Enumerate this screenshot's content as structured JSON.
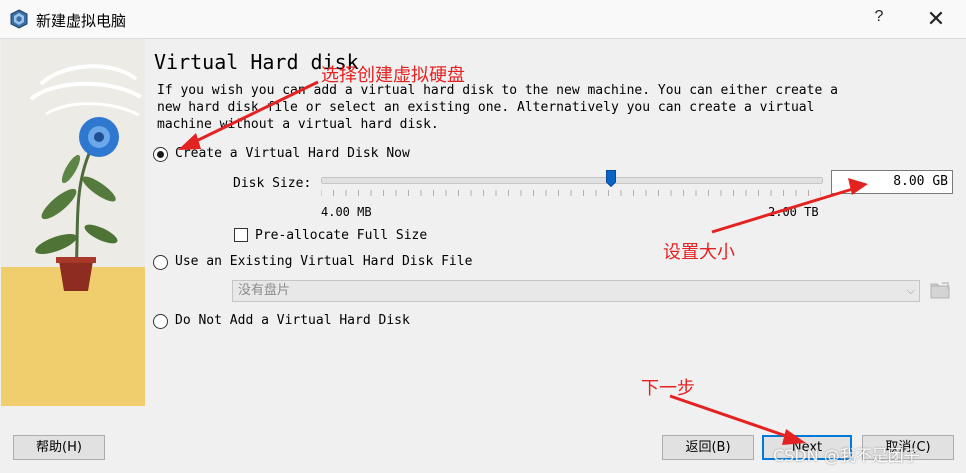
{
  "window": {
    "title": "新建虚拟电脑",
    "help_glyph": "?",
    "close_glyph": "✕"
  },
  "page": {
    "heading": "Virtual Hard disk",
    "description": "If you wish you can add a virtual hard disk to the new machine. You can either create a new hard disk file or select an existing one. Alternatively you can create a virtual machine without a virtual hard disk."
  },
  "options": {
    "create": {
      "label": "Create a Virtual Hard Disk Now",
      "checked": true
    },
    "existing": {
      "label": "Use an Existing Virtual Hard Disk File",
      "checked": false
    },
    "none": {
      "label": "Do Not Add a Virtual Hard Disk",
      "checked": false
    }
  },
  "disk": {
    "size_label": "Disk Size:",
    "min_label": "4.00 MB",
    "max_label": "2.00 TB",
    "value": "8.00 GB",
    "slider_fraction": 0.58,
    "preallocate_label": "Pre-allocate Full Size",
    "preallocate_checked": false
  },
  "existing_disk": {
    "selected": "没有盘片",
    "arrow": "⌵"
  },
  "buttons": {
    "help": "帮助(H)",
    "back": "返回(B)",
    "next": "Next",
    "cancel": "取消(C)"
  },
  "annotations": {
    "select_create": "选择创建虚拟硬盘",
    "set_size": "设置大小",
    "next_step": "下一步",
    "color": "#e52222"
  },
  "watermark": "CSDN @我不是团子"
}
